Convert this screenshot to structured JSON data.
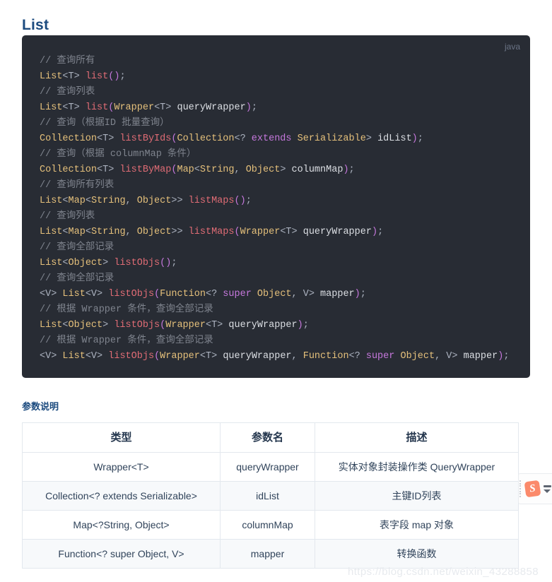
{
  "page": {
    "title": "List",
    "params_heading": "参数说明",
    "watermark": "https://blog.csdn.net/weixin_43288858"
  },
  "code_block": {
    "language_label": "java",
    "lines": [
      [
        {
          "t": "// 查询所有",
          "c": "tk-comment"
        }
      ],
      [
        {
          "t": "List",
          "c": "tk-type"
        },
        {
          "t": "<T>",
          "c": "tk-punc"
        },
        {
          "t": " ",
          "c": "tk-punc"
        },
        {
          "t": "list",
          "c": "tk-fn"
        },
        {
          "t": "()",
          "c": "tk-paren"
        },
        {
          "t": ";",
          "c": "tk-punc"
        }
      ],
      [
        {
          "t": "// 查询列表",
          "c": "tk-comment"
        }
      ],
      [
        {
          "t": "List",
          "c": "tk-type"
        },
        {
          "t": "<T>",
          "c": "tk-punc"
        },
        {
          "t": " ",
          "c": "tk-punc"
        },
        {
          "t": "list",
          "c": "tk-fn"
        },
        {
          "t": "(",
          "c": "tk-paren"
        },
        {
          "t": "Wrapper",
          "c": "tk-type"
        },
        {
          "t": "<T>",
          "c": "tk-punc"
        },
        {
          "t": " ",
          "c": "tk-punc"
        },
        {
          "t": "queryWrapper",
          "c": "tk-var"
        },
        {
          "t": ")",
          "c": "tk-paren"
        },
        {
          "t": ";",
          "c": "tk-punc"
        }
      ],
      [
        {
          "t": "// 查询（根据ID 批量查询）",
          "c": "tk-comment"
        }
      ],
      [
        {
          "t": "Collection",
          "c": "tk-type"
        },
        {
          "t": "<T>",
          "c": "tk-punc"
        },
        {
          "t": " ",
          "c": "tk-punc"
        },
        {
          "t": "listByIds",
          "c": "tk-fn"
        },
        {
          "t": "(",
          "c": "tk-paren"
        },
        {
          "t": "Collection",
          "c": "tk-type"
        },
        {
          "t": "<?",
          "c": "tk-punc"
        },
        {
          "t": " ",
          "c": "tk-punc"
        },
        {
          "t": "extends",
          "c": "tk-kw"
        },
        {
          "t": " ",
          "c": "tk-punc"
        },
        {
          "t": "Serializable",
          "c": "tk-type"
        },
        {
          "t": ">",
          "c": "tk-punc"
        },
        {
          "t": " ",
          "c": "tk-punc"
        },
        {
          "t": "idList",
          "c": "tk-var"
        },
        {
          "t": ")",
          "c": "tk-paren"
        },
        {
          "t": ";",
          "c": "tk-punc"
        }
      ],
      [
        {
          "t": "// 查询（根据 columnMap 条件）",
          "c": "tk-comment"
        }
      ],
      [
        {
          "t": "Collection",
          "c": "tk-type"
        },
        {
          "t": "<T>",
          "c": "tk-punc"
        },
        {
          "t": " ",
          "c": "tk-punc"
        },
        {
          "t": "listByMap",
          "c": "tk-fn"
        },
        {
          "t": "(",
          "c": "tk-paren"
        },
        {
          "t": "Map",
          "c": "tk-type"
        },
        {
          "t": "<",
          "c": "tk-punc"
        },
        {
          "t": "String",
          "c": "tk-type"
        },
        {
          "t": ", ",
          "c": "tk-punc"
        },
        {
          "t": "Object",
          "c": "tk-type"
        },
        {
          "t": "> ",
          "c": "tk-punc"
        },
        {
          "t": "columnMap",
          "c": "tk-var"
        },
        {
          "t": ")",
          "c": "tk-paren"
        },
        {
          "t": ";",
          "c": "tk-punc"
        }
      ],
      [
        {
          "t": "// 查询所有列表",
          "c": "tk-comment"
        }
      ],
      [
        {
          "t": "List",
          "c": "tk-type"
        },
        {
          "t": "<",
          "c": "tk-punc"
        },
        {
          "t": "Map",
          "c": "tk-type"
        },
        {
          "t": "<",
          "c": "tk-punc"
        },
        {
          "t": "String",
          "c": "tk-type"
        },
        {
          "t": ", ",
          "c": "tk-punc"
        },
        {
          "t": "Object",
          "c": "tk-type"
        },
        {
          "t": ">> ",
          "c": "tk-punc"
        },
        {
          "t": "listMaps",
          "c": "tk-fn"
        },
        {
          "t": "()",
          "c": "tk-paren"
        },
        {
          "t": ";",
          "c": "tk-punc"
        }
      ],
      [
        {
          "t": "// 查询列表",
          "c": "tk-comment"
        }
      ],
      [
        {
          "t": "List",
          "c": "tk-type"
        },
        {
          "t": "<",
          "c": "tk-punc"
        },
        {
          "t": "Map",
          "c": "tk-type"
        },
        {
          "t": "<",
          "c": "tk-punc"
        },
        {
          "t": "String",
          "c": "tk-type"
        },
        {
          "t": ", ",
          "c": "tk-punc"
        },
        {
          "t": "Object",
          "c": "tk-type"
        },
        {
          "t": ">> ",
          "c": "tk-punc"
        },
        {
          "t": "listMaps",
          "c": "tk-fn"
        },
        {
          "t": "(",
          "c": "tk-paren"
        },
        {
          "t": "Wrapper",
          "c": "tk-type"
        },
        {
          "t": "<T>",
          "c": "tk-punc"
        },
        {
          "t": " ",
          "c": "tk-punc"
        },
        {
          "t": "queryWrapper",
          "c": "tk-var"
        },
        {
          "t": ")",
          "c": "tk-paren"
        },
        {
          "t": ";",
          "c": "tk-punc"
        }
      ],
      [
        {
          "t": "// 查询全部记录",
          "c": "tk-comment"
        }
      ],
      [
        {
          "t": "List",
          "c": "tk-type"
        },
        {
          "t": "<",
          "c": "tk-punc"
        },
        {
          "t": "Object",
          "c": "tk-type"
        },
        {
          "t": "> ",
          "c": "tk-punc"
        },
        {
          "t": "listObjs",
          "c": "tk-fn"
        },
        {
          "t": "()",
          "c": "tk-paren"
        },
        {
          "t": ";",
          "c": "tk-punc"
        }
      ],
      [
        {
          "t": "// 查询全部记录",
          "c": "tk-comment"
        }
      ],
      [
        {
          "t": "<V>",
          "c": "tk-punc"
        },
        {
          "t": " ",
          "c": "tk-punc"
        },
        {
          "t": "List",
          "c": "tk-type"
        },
        {
          "t": "<V>",
          "c": "tk-punc"
        },
        {
          "t": " ",
          "c": "tk-punc"
        },
        {
          "t": "listObjs",
          "c": "tk-fn"
        },
        {
          "t": "(",
          "c": "tk-paren"
        },
        {
          "t": "Function",
          "c": "tk-type"
        },
        {
          "t": "<?",
          "c": "tk-punc"
        },
        {
          "t": " ",
          "c": "tk-punc"
        },
        {
          "t": "super",
          "c": "tk-kw"
        },
        {
          "t": " ",
          "c": "tk-punc"
        },
        {
          "t": "Object",
          "c": "tk-type"
        },
        {
          "t": ", V> ",
          "c": "tk-punc"
        },
        {
          "t": "mapper",
          "c": "tk-var"
        },
        {
          "t": ")",
          "c": "tk-paren"
        },
        {
          "t": ";",
          "c": "tk-punc"
        }
      ],
      [
        {
          "t": "// 根据 Wrapper 条件，查询全部记录",
          "c": "tk-comment"
        }
      ],
      [
        {
          "t": "List",
          "c": "tk-type"
        },
        {
          "t": "<",
          "c": "tk-punc"
        },
        {
          "t": "Object",
          "c": "tk-type"
        },
        {
          "t": "> ",
          "c": "tk-punc"
        },
        {
          "t": "listObjs",
          "c": "tk-fn"
        },
        {
          "t": "(",
          "c": "tk-paren"
        },
        {
          "t": "Wrapper",
          "c": "tk-type"
        },
        {
          "t": "<T>",
          "c": "tk-punc"
        },
        {
          "t": " ",
          "c": "tk-punc"
        },
        {
          "t": "queryWrapper",
          "c": "tk-var"
        },
        {
          "t": ")",
          "c": "tk-paren"
        },
        {
          "t": ";",
          "c": "tk-punc"
        }
      ],
      [
        {
          "t": "// 根据 Wrapper 条件，查询全部记录",
          "c": "tk-comment"
        }
      ],
      [
        {
          "t": "<V>",
          "c": "tk-punc"
        },
        {
          "t": " ",
          "c": "tk-punc"
        },
        {
          "t": "List",
          "c": "tk-type"
        },
        {
          "t": "<V>",
          "c": "tk-punc"
        },
        {
          "t": " ",
          "c": "tk-punc"
        },
        {
          "t": "listObjs",
          "c": "tk-fn"
        },
        {
          "t": "(",
          "c": "tk-paren"
        },
        {
          "t": "Wrapper",
          "c": "tk-type"
        },
        {
          "t": "<T>",
          "c": "tk-punc"
        },
        {
          "t": " ",
          "c": "tk-punc"
        },
        {
          "t": "queryWrapper",
          "c": "tk-var"
        },
        {
          "t": ", ",
          "c": "tk-punc"
        },
        {
          "t": "Function",
          "c": "tk-type"
        },
        {
          "t": "<?",
          "c": "tk-punc"
        },
        {
          "t": " ",
          "c": "tk-punc"
        },
        {
          "t": "super",
          "c": "tk-kw"
        },
        {
          "t": " ",
          "c": "tk-punc"
        },
        {
          "t": "Object",
          "c": "tk-type"
        },
        {
          "t": ", V> ",
          "c": "tk-punc"
        },
        {
          "t": "mapper",
          "c": "tk-var"
        },
        {
          "t": ")",
          "c": "tk-paren"
        },
        {
          "t": ";",
          "c": "tk-punc"
        }
      ]
    ]
  },
  "param_table": {
    "headers": [
      "类型",
      "参数名",
      "描述"
    ],
    "rows": [
      [
        "Wrapper<T>",
        "queryWrapper",
        "实体对象封装操作类 QueryWrapper"
      ],
      [
        "Collection<? extends Serializable>",
        "idList",
        "主键ID列表"
      ],
      [
        "Map<?String, Object>",
        "columnMap",
        "表字段 map 对象"
      ],
      [
        "Function<? super Object, V>",
        "mapper",
        "转换函数"
      ]
    ]
  },
  "ime_bar": {
    "logo_label": "S"
  },
  "colors": {
    "page_background": "#ffffff",
    "heading": "#1c4b7f",
    "code_background": "#282c34",
    "code_comment": "#7f848e",
    "code_type": "#e5c07b",
    "code_function": "#e06c75",
    "code_keyword": "#c678dd",
    "code_punctuation": "#abb2bf",
    "code_variable": "#dcdfe4",
    "table_border": "#e3e8ee",
    "table_stripe": "#f7f9fb",
    "watermark": "#e7eaee",
    "ime_accent": "#fb8a6b"
  }
}
